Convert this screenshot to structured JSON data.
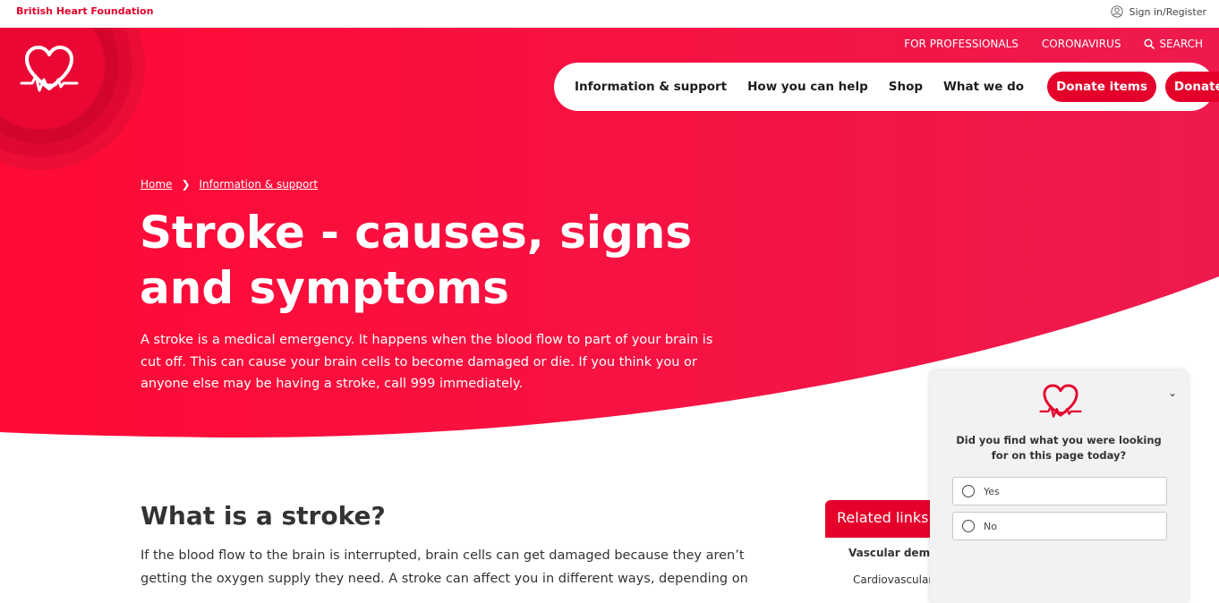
{
  "utility": {
    "brand": "British Heart Foundation",
    "signin": "Sign in/Register"
  },
  "secondary_nav": {
    "professionals": "FOR PROFESSIONALS",
    "coronavirus": "CORONAVIRUS",
    "search": "SEARCH"
  },
  "main_nav": {
    "items": [
      "Information & support",
      "How you can help",
      "Shop",
      "What we do"
    ],
    "donate_items": "Donate items",
    "donate_money": "Donate money"
  },
  "breadcrumb": {
    "home": "Home",
    "section": "Information & support"
  },
  "hero": {
    "title": "Stroke - causes, signs and symptoms",
    "intro": "A stroke is a medical emergency. It happens when the blood flow to part of your brain is cut off. This can cause your brain cells to become damaged or die. If you think you or anyone else may be having a stroke, call 999 immediately."
  },
  "content": {
    "heading": "What is a stroke?",
    "paragraph": "If the blood flow to the brain is interrupted, brain cells can get damaged because they aren’t getting the oxygen supply they need. A stroke can affect you in different ways, depending on"
  },
  "related": {
    "heading": "Related links",
    "link1": "Vascular demen",
    "link2": "Cardiovascular"
  },
  "feedback": {
    "question": "Did you find what you were looking for on this page today?",
    "yes": "Yes",
    "no": "No"
  },
  "colors": {
    "brand_red": "#e4002b",
    "hero_pink": "#ff0037"
  }
}
